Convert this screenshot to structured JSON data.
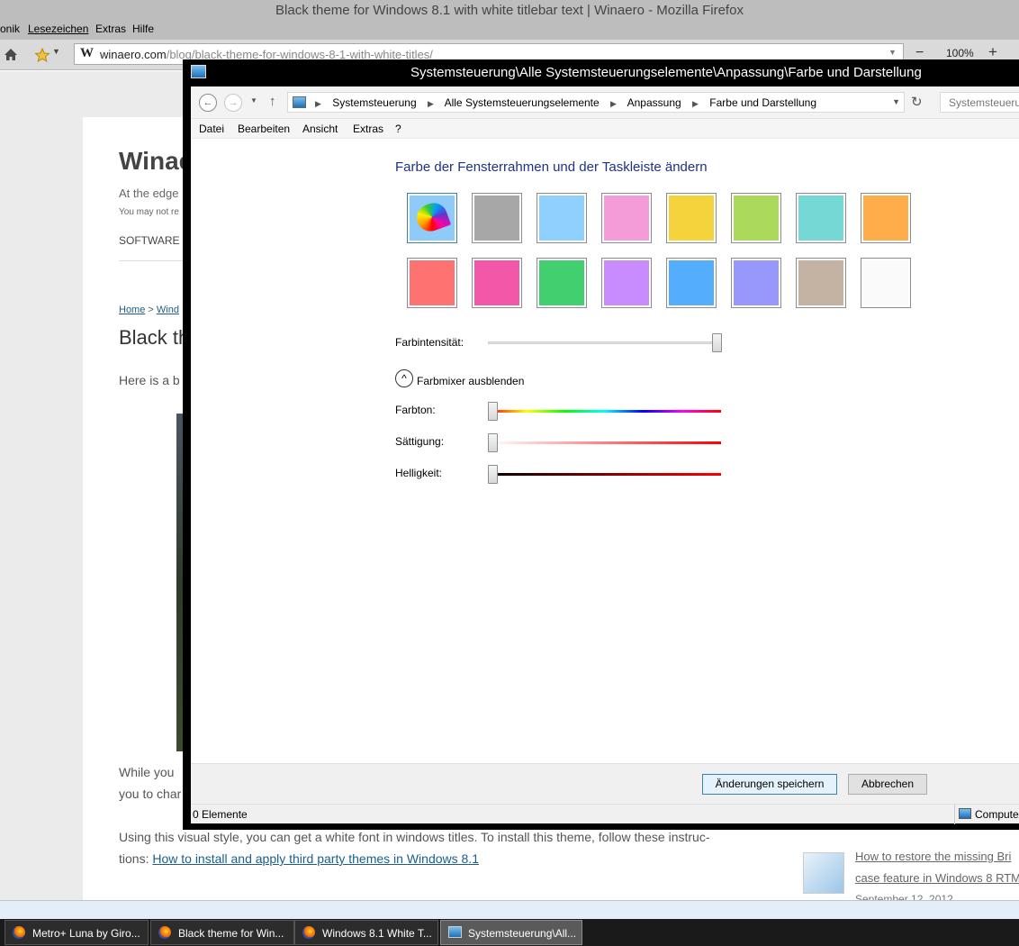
{
  "browser": {
    "title": "Black theme for Windows 8.1 with white titlebar text | Winaero - Mozilla Firefox",
    "menu": [
      "onik",
      "Lesezeichen",
      "Extras",
      "Hilfe"
    ],
    "url_domain": "winaero.com",
    "url_path": "/blog/black-theme-for-windows-8-1-with-white-titles/",
    "zoom": "100%",
    "page": {
      "site_title": "Winae",
      "tagline": "At the edge",
      "notice": "You may not re",
      "nav_item": "SOFTWARE",
      "breadcrumb_home": "Home",
      "breadcrumb_sep": " > ",
      "breadcrumb_next": "Wind",
      "post_title": "Black th",
      "intro": "Here is a b",
      "para1_a": "While you",
      "para1_b": "you to char",
      "para2_a": "Using this visual style, you can get a white font in windows titles. To install this theme, follow these instruc-",
      "para2_b_prefix": "tions: ",
      "para2_link": "How to install and apply third party themes in Windows 8.1",
      "sidebar_link_1": "How to restore the missing Bri",
      "sidebar_link_2": "case feature in Windows 8 RTM",
      "sidebar_date": "September 12, 2012"
    }
  },
  "taskbar": {
    "buttons": [
      "Metro+ Luna by Giro...",
      "Black theme for Win...",
      "Windows 8.1 White T...",
      "Systemsteuerung\\All..."
    ]
  },
  "control_panel": {
    "title": "Systemsteuerung\\Alle Systemsteuerungselemente\\Anpassung\\Farbe und Darstellung",
    "breadcrumb": [
      "Systemsteuerung",
      "Alle Systemsteuerungselemente",
      "Anpassung",
      "Farbe und Darstellung"
    ],
    "search_placeholder": "Systemsteueru",
    "menu": [
      "Datei",
      "Bearbeiten",
      "Ansicht",
      "Extras",
      "?"
    ],
    "heading": "Farbe der Fensterrahmen und der Taskleiste ändern",
    "swatches": [
      "#8fcaf9",
      "#a7a7a7",
      "#8fd0ff",
      "#f49cd8",
      "#f4d33c",
      "#abd95c",
      "#76d8d4",
      "#ffac4a",
      "#ff7272",
      "#f358a8",
      "#41cf70",
      "#c88cff",
      "#55aefd",
      "#9898fc",
      "#c4b2a3",
      "#fafafa"
    ],
    "intensity_label": "Farbintensität:",
    "intensity_value": 1.0,
    "mixer_toggle_label": "Farbmixer ausblenden",
    "hue_label": "Farbton:",
    "hue_value": 0,
    "saturation_label": "Sättigung:",
    "saturation_value": 0,
    "brightness_label": "Helligkeit:",
    "brightness_value": 0,
    "save_button": "Änderungen speichern",
    "cancel_button": "Abbrechen",
    "status_items": "0 Elemente",
    "status_zone": "Compute"
  }
}
